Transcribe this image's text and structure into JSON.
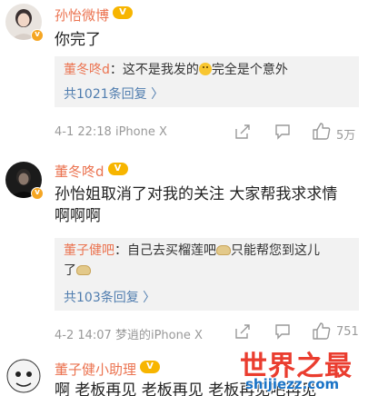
{
  "comments": [
    {
      "username": "孙怡微博",
      "text": "你完了",
      "reply": {
        "user": "董冬咚d",
        "sep": "：",
        "text_before_emoji": "这不是我发的",
        "text_after_emoji": "完全是个意外",
        "more": "共1021条回复 〉"
      },
      "meta": "4-1 22:18  iPhone X",
      "likes": "5万"
    },
    {
      "username": "董冬咚d",
      "text_line1": "孙怡姐取消了对我的关注 大家帮我求求情",
      "text_line2": "啊啊啊",
      "reply": {
        "user": "董子健吧",
        "sep": "：",
        "text_before_emoji": "自己去买榴莲吧",
        "text_after_emoji": "只能帮您到这儿",
        "text_line2": "了",
        "more": "共103条回复 〉"
      },
      "meta": "4-2 14:07  梦逍的iPhone X",
      "likes": "751"
    },
    {
      "username": "董子健小助理",
      "text": "啊 老板再见    老板再见    老板再见吧再见"
    }
  ],
  "watermark": {
    "title": "世界之最",
    "url": "shijiezz.com"
  },
  "colors": {
    "username": "#eb7350",
    "link": "#507daf",
    "reply_bg": "#f2f2f2",
    "meta": "#999999",
    "watermark_red": "#ea3d2f",
    "watermark_blue": "#1a73c6"
  }
}
